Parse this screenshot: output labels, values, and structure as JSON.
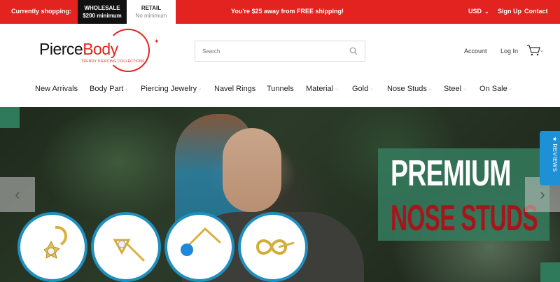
{
  "topbar": {
    "currently_shopping": "Currently shopping:",
    "wholesale_label": "WHOLESALE",
    "wholesale_sub": "$200 minimum",
    "retail_label": "RETAIL",
    "retail_sub": "No minimum",
    "shipping_message": "You're $25 away from FREE shipping!",
    "currency": "USD",
    "sign_up": "Sign Up",
    "contact": "Contact"
  },
  "header": {
    "logo_left": "Pierce",
    "logo_right": "Body",
    "logo_tagline": "TRENDY PIERCING COLLECTIONS",
    "search_placeholder": "Search",
    "account": "Account",
    "login": "Log In"
  },
  "nav": {
    "items": [
      {
        "label": "New Arrivals",
        "has_dropdown": false
      },
      {
        "label": "Body Part",
        "has_dropdown": true
      },
      {
        "label": "Piercing Jewelry",
        "has_dropdown": true
      },
      {
        "label": "Navel Rings",
        "has_dropdown": false
      },
      {
        "label": "Tunnels",
        "has_dropdown": false
      },
      {
        "label": "Material",
        "has_dropdown": true
      },
      {
        "label": "Gold",
        "has_dropdown": true
      },
      {
        "label": "Nose Studs",
        "has_dropdown": true
      },
      {
        "label": "Steel",
        "has_dropdown": true
      },
      {
        "label": "On Sale",
        "has_dropdown": true
      }
    ],
    "dropdown_glyph": "⌄"
  },
  "hero": {
    "headline_line1": "PREMIUM",
    "headline_line2": "NOSE STUDS",
    "prev_arrow": "‹",
    "next_arrow": "›",
    "reviews_tab": "★ REVIEWS"
  },
  "colors": {
    "brand_red": "#e2231f",
    "promo_green": "#347a5c",
    "promo_text_red": "#a3171c",
    "circle_border": "#1f8fbf",
    "reviews_blue": "#1e90d6"
  },
  "icons": [
    "search-icon",
    "cart-icon",
    "chevron-down-icon",
    "arrow-left-icon",
    "arrow-right-icon"
  ]
}
